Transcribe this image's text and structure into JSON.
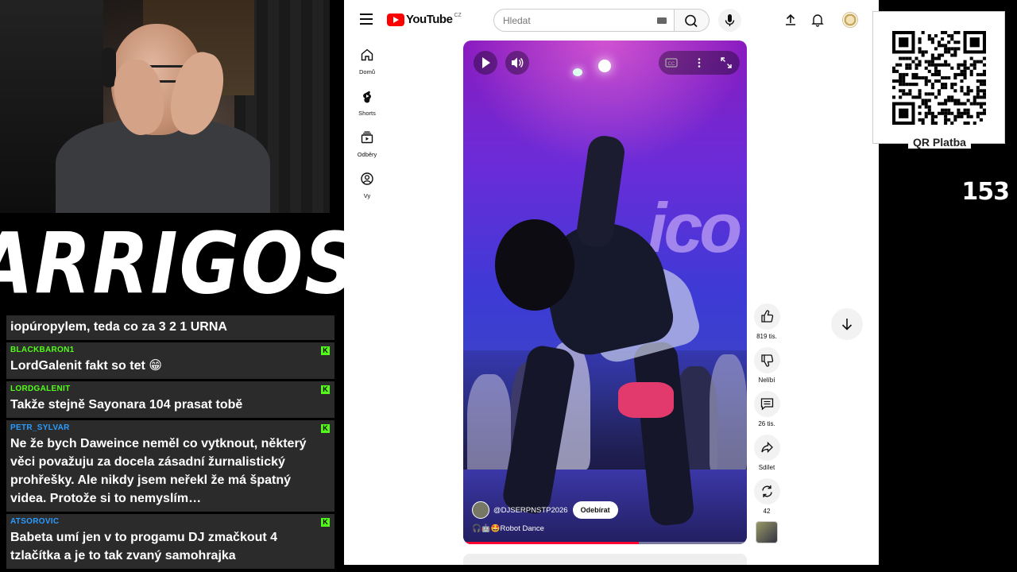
{
  "stream": {
    "logo_text": "ARRIGOS",
    "counter": "153",
    "qr_label": "QR Platba"
  },
  "chat": [
    {
      "user": "",
      "text": "iopúropylem, teda co za 3 2 1 URNA",
      "color": "#ffffff"
    },
    {
      "user": "BLACKBARON1",
      "text": "LordGalenit fakt so tet 😁",
      "color": "#53fc18"
    },
    {
      "user": "LORDGALENIT",
      "text": "Takže stejně Sayonara 104 prasat tobě",
      "color": "#53fc18"
    },
    {
      "user": "PETR_SYLVAR",
      "text": "Ne že bych Daweince neměl co vytknout, některý věci považuju za docela zásadní žurnalistický prohřešky. Ale nikdy jsem neřekl že má špatný videa. Protože si to nemyslím…",
      "color": "#2a9bff"
    },
    {
      "user": "ATSOROVIC",
      "text": "Babeta umí jen v to progamu DJ zmačkout 4 tzlačítka a je to tak zvaný samohrajka",
      "color": "#2a9bff"
    }
  ],
  "chat_badge": "K",
  "youtube": {
    "logo": "YouTube",
    "country": "CZ",
    "search_placeholder": "Hledat",
    "sidebar": [
      {
        "label": "Domů"
      },
      {
        "label": "Shorts"
      },
      {
        "label": "Odběry"
      },
      {
        "label": "Vy"
      }
    ],
    "video": {
      "channel": "@DJSERPNSTP2026",
      "subscribe": "Odebírat",
      "title": "🎧🤖🤩Robot Dance",
      "progress": 0.62
    },
    "actions": {
      "like": "819 tis.",
      "dislike": "Nelíbí",
      "comments": "26 tis.",
      "share": "Sdílet",
      "remix": "42"
    }
  }
}
